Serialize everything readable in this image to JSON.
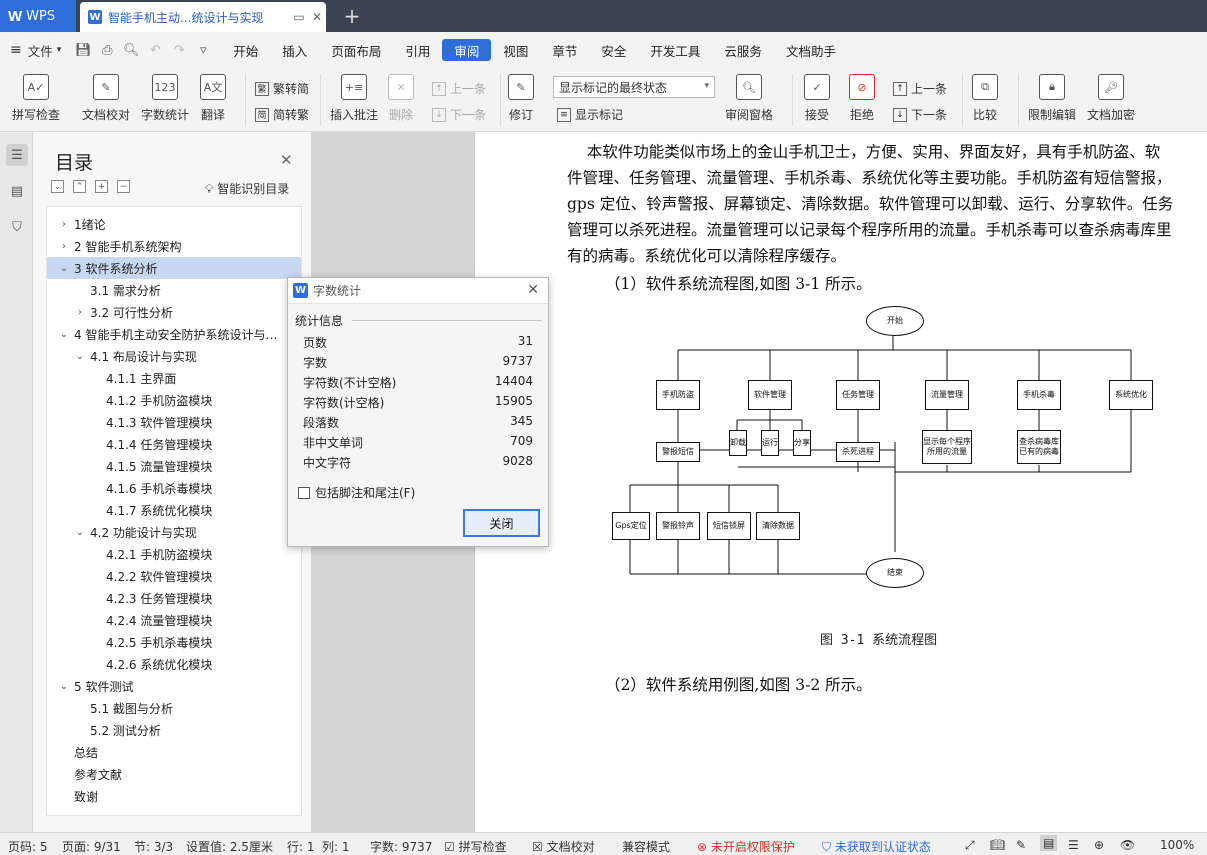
{
  "titlebar": {
    "app_label": "WPS",
    "doc_tab_title": "智能手机主动...统设计与实现",
    "new_tab": "+"
  },
  "menubar": {
    "file": "文件",
    "items": [
      "开始",
      "插入",
      "页面布局",
      "引用",
      "审阅",
      "视图",
      "章节",
      "安全",
      "开发工具",
      "云服务",
      "文档助手"
    ],
    "active": "审阅"
  },
  "ribbon": {
    "spellcheck": "拼写检查",
    "doc_proof": "文档校对",
    "word_count": "字数统计",
    "translate": "翻译",
    "to_traditional": "繁转简",
    "to_simplified": "简转繁",
    "insert_comment": "插入批注",
    "delete": "删除",
    "prev_comment": "上一条",
    "next_comment": "下一条",
    "revise": "修订",
    "track_mode": "显示标记的最终状态",
    "show_markup": "显示标记",
    "review_pane": "审阅窗格",
    "accept": "接受",
    "reject": "拒绝",
    "prev": "上一条",
    "next": "下一条",
    "compare": "比较",
    "restrict_edit": "限制编辑",
    "encrypt": "文档加密"
  },
  "toc": {
    "title": "目录",
    "smart_label": "智能识别目录",
    "items": [
      {
        "label": "1绪论",
        "level": 1,
        "chev": "›",
        "selected": false
      },
      {
        "label": "2  智能手机系统架构",
        "level": 1,
        "chev": "›",
        "selected": false
      },
      {
        "label": "3  软件系统分析",
        "level": 1,
        "chev": "⌄",
        "selected": true
      },
      {
        "label": "3.1  需求分析",
        "level": 2,
        "chev": "",
        "selected": false
      },
      {
        "label": "3.2  可行性分析",
        "level": 2,
        "chev": "›",
        "selected": false
      },
      {
        "label": "4  智能手机主动安全防护系统设计与…",
        "level": 1,
        "chev": "⌄",
        "selected": false
      },
      {
        "label": "4.1  布局设计与实现",
        "level": 2,
        "chev": "⌄",
        "selected": false
      },
      {
        "label": "4.1.1  主界面",
        "level": 3,
        "chev": "",
        "selected": false
      },
      {
        "label": "4.1.2  手机防盗模块",
        "level": 3,
        "chev": "",
        "selected": false
      },
      {
        "label": "4.1.3  软件管理模块",
        "level": 3,
        "chev": "",
        "selected": false
      },
      {
        "label": "4.1.4  任务管理模块",
        "level": 3,
        "chev": "",
        "selected": false
      },
      {
        "label": "4.1.5  流量管理模块",
        "level": 3,
        "chev": "",
        "selected": false
      },
      {
        "label": "4.1.6  手机杀毒模块",
        "level": 3,
        "chev": "",
        "selected": false
      },
      {
        "label": "4.1.7  系统优化模块",
        "level": 3,
        "chev": "",
        "selected": false
      },
      {
        "label": "4.2 功能设计与实现",
        "level": 2,
        "chev": "⌄",
        "selected": false
      },
      {
        "label": "4.2.1  手机防盗模块",
        "level": 3,
        "chev": "",
        "selected": false
      },
      {
        "label": "4.2.2  软件管理模块",
        "level": 3,
        "chev": "",
        "selected": false
      },
      {
        "label": "4.2.3  任务管理模块",
        "level": 3,
        "chev": "",
        "selected": false
      },
      {
        "label": "4.2.4  流量管理模块",
        "level": 3,
        "chev": "",
        "selected": false
      },
      {
        "label": "4.2.5  手机杀毒模块",
        "level": 3,
        "chev": "",
        "selected": false
      },
      {
        "label": "4.2.6  系统优化模块",
        "level": 3,
        "chev": "",
        "selected": false
      },
      {
        "label": "5  软件测试",
        "level": 1,
        "chev": "⌄",
        "selected": false
      },
      {
        "label": "5.1 截图与分析",
        "level": 2,
        "chev": "",
        "selected": false
      },
      {
        "label": "5.2  测试分析",
        "level": 2,
        "chev": "",
        "selected": false
      },
      {
        "label": "总结",
        "level": 1,
        "chev": "",
        "selected": false
      },
      {
        "label": "参考文献",
        "level": 1,
        "chev": "",
        "selected": false
      },
      {
        "label": "致谢",
        "level": 1,
        "chev": "",
        "selected": false
      }
    ]
  },
  "document": {
    "lines": [
      "    本软件功能类似市场上的金山手机卫士，方便、实用、界面友好，具有手机防盗、软",
      "件管理、任务管理、流量管理、手机杀毒、系统优化等主要功能。手机防盗有短信警报，",
      "gps 定位、铃声警报、屏幕锁定、清除数据。软件管理可以卸载、运行、分享软件。任务",
      "管理可以杀死进程。流量管理可以记录每个程序所用的流量。手机杀毒可以查杀病毒库里",
      "有的病毒。系统优化可以清除程序缓存。"
    ],
    "flow_intro": "（1）软件系统流程图,如图 3-1 所示。",
    "figure_caption": "图 3-1 系统流程图",
    "usecase_intro": "（2）软件系统用例图,如图 3-2 所示。"
  },
  "flowchart": {
    "start": "开始",
    "end": "结束",
    "modules": [
      "手机防盗",
      "软件管理",
      "任务管理",
      "流量管理",
      "手机杀毒",
      "系统优化"
    ],
    "sub_antitheft_alarm": "警报短信",
    "sub_software": [
      "卸载",
      "运行",
      "分享"
    ],
    "sub_task": "杀死进程",
    "sub_traffic": "显示每个程序所用的流量",
    "sub_virus": "查杀病毒库已有的病毒",
    "sub_antitheft": [
      "Gps定位",
      "警报铃声",
      "短信锁屏",
      "清除数据"
    ]
  },
  "dialog": {
    "title": "字数统计",
    "section": "统计信息",
    "stats": [
      {
        "label": "页数",
        "value": "31"
      },
      {
        "label": "字数",
        "value": "9737"
      },
      {
        "label": "字符数(不计空格)",
        "value": "14404"
      },
      {
        "label": "字符数(计空格)",
        "value": "15905"
      },
      {
        "label": "段落数",
        "value": "345"
      },
      {
        "label": "非中文单词",
        "value": "709"
      },
      {
        "label": "中文字符",
        "value": "9028"
      }
    ],
    "checkbox": "包括脚注和尾注(F)",
    "close_btn": "关闭"
  },
  "statusbar": {
    "page_code": "页码: 5",
    "page": "页面: 9/31",
    "section": "节: 3/3",
    "setting": "设置值: 2.5厘米",
    "row": "行: 1",
    "col": "列: 1",
    "word_count": "字数: 9737",
    "spellcheck": "拼写检查",
    "doc_proof": "文档校对",
    "compat": "兼容模式",
    "permission": "未开启权限保护",
    "auth": "未获取到认证状态",
    "zoom": "100%"
  },
  "colors": {
    "accent": "#2f6ed9",
    "toc_selected": "#c9d8f2",
    "warning": "#d0312d",
    "auth_link": "#2f6ed9"
  }
}
